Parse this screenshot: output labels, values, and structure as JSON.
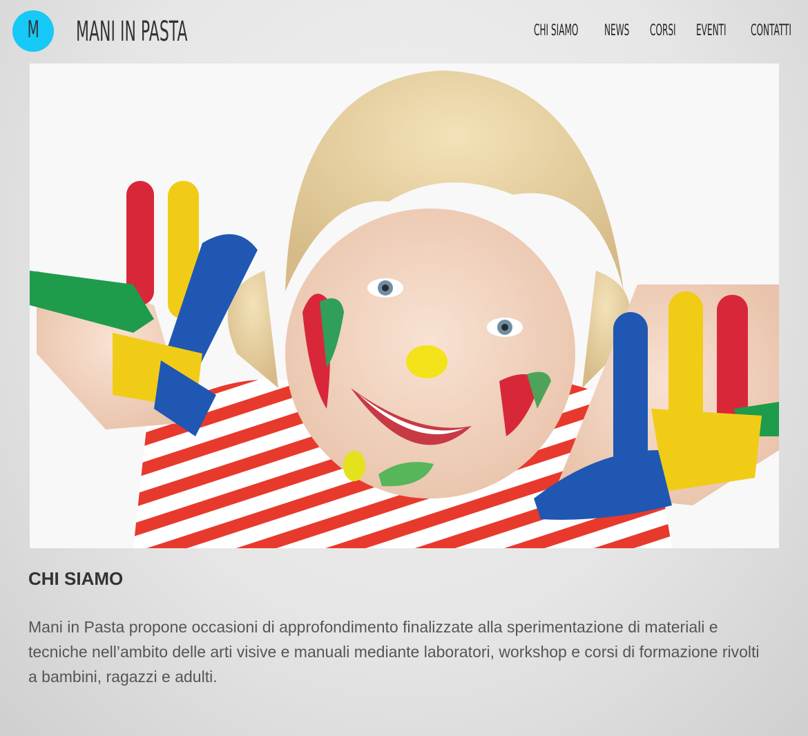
{
  "header": {
    "logo_letter": "M",
    "brand": "MANI IN PASTA",
    "accent_color": "#16c9f6"
  },
  "nav": {
    "items": [
      {
        "label": "CHI SIAMO"
      },
      {
        "label": "NEWS"
      },
      {
        "label": "CORSI"
      },
      {
        "label": "EVENTI"
      },
      {
        "label": "CONTATTI"
      }
    ]
  },
  "hero": {
    "image": "child-painted-hands-photo"
  },
  "about": {
    "title": "CHI SIAMO",
    "text": "Mani in Pasta propone occasioni di approfondimento finalizzate alla sperimentazione di materiali e tecniche nell’ambito delle arti visive e manuali mediante laboratori, workshop e corsi di formazione rivolti a bambini, ragazzi e adulti."
  }
}
